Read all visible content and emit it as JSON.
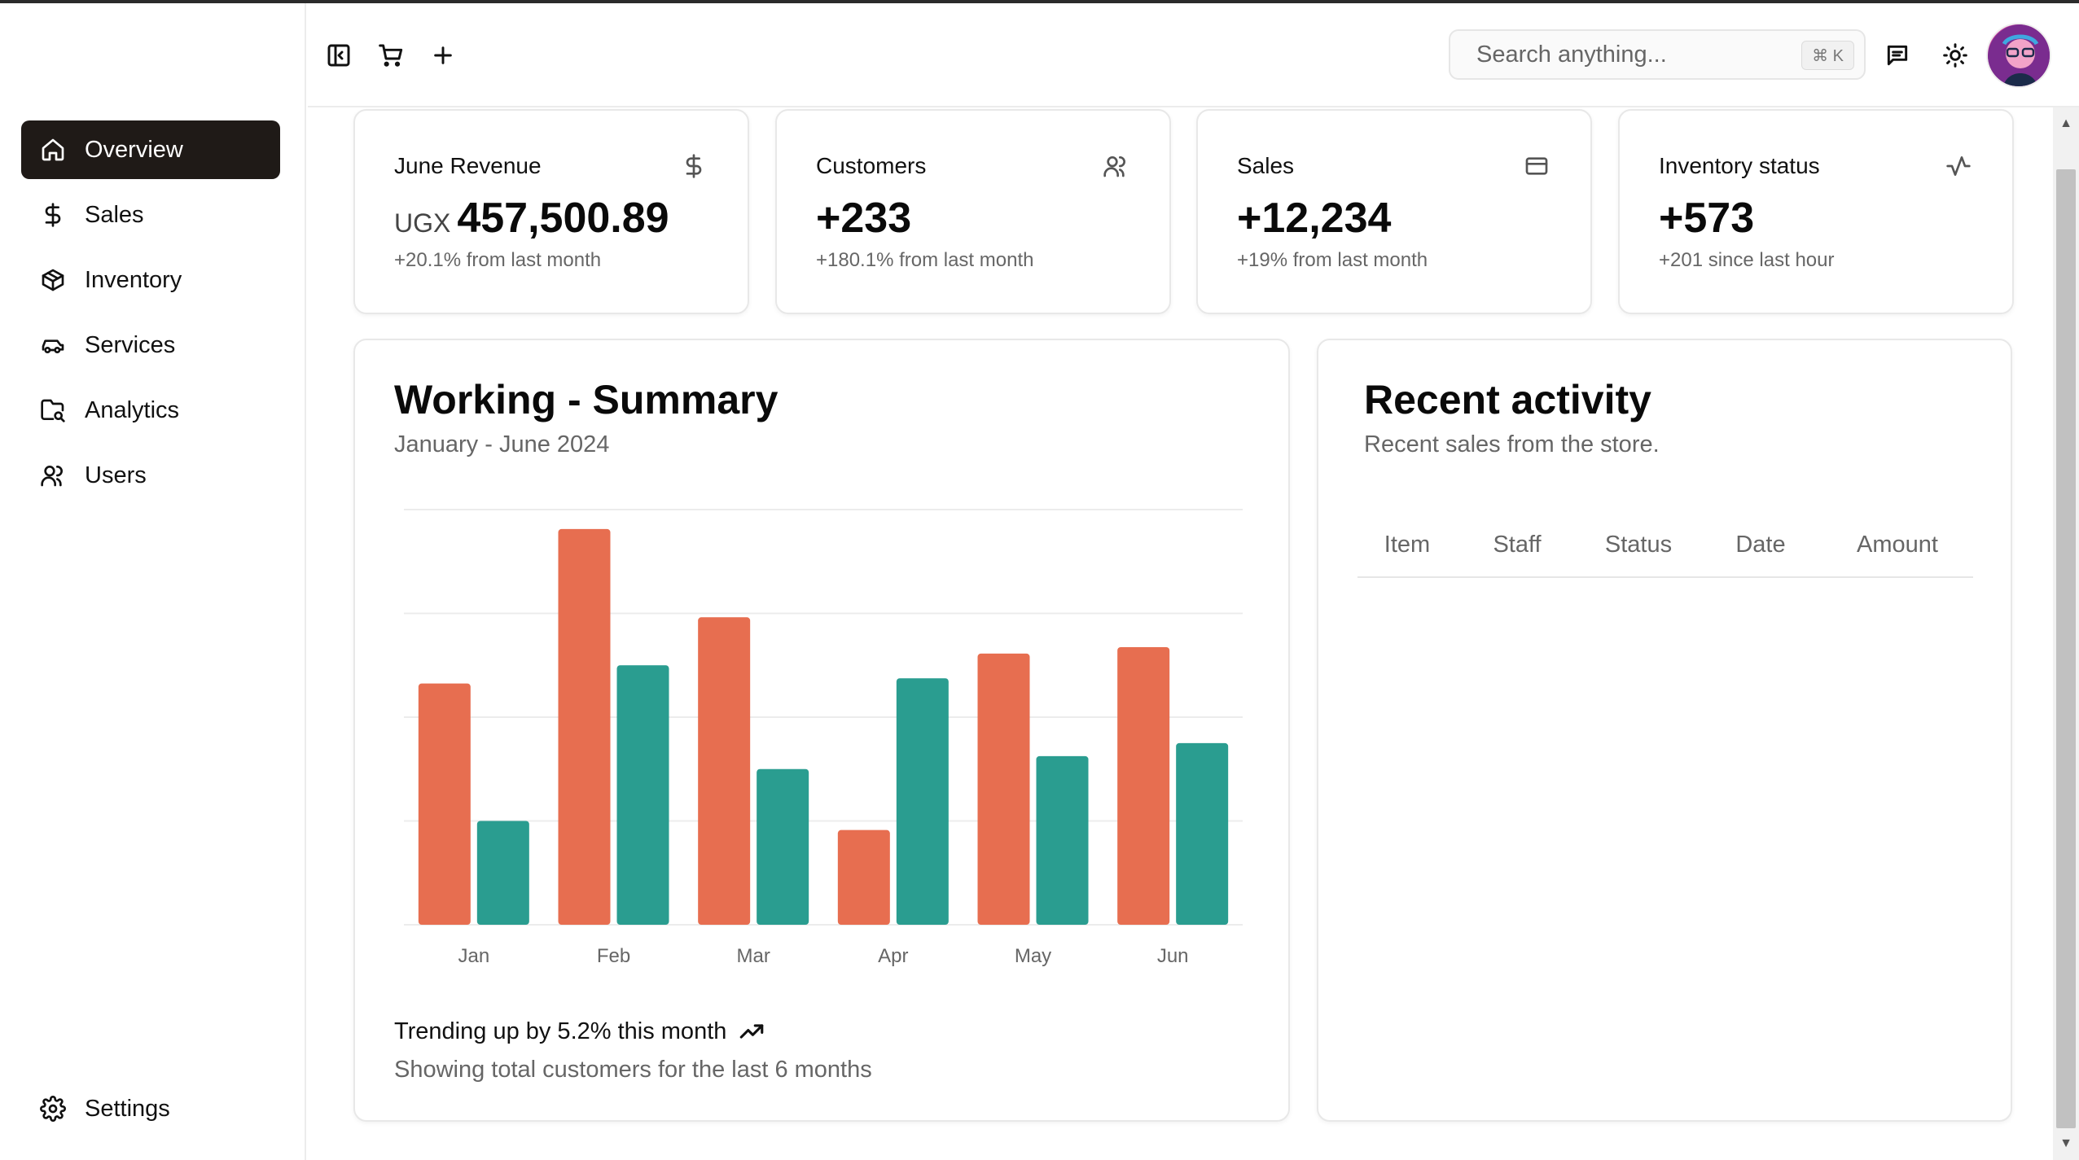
{
  "sidebar": {
    "items": [
      {
        "label": "Overview",
        "icon": "home-icon"
      },
      {
        "label": "Sales",
        "icon": "dollar-icon"
      },
      {
        "label": "Inventory",
        "icon": "package-icon"
      },
      {
        "label": "Services",
        "icon": "car-icon"
      },
      {
        "label": "Analytics",
        "icon": "folder-chart-icon"
      },
      {
        "label": "Users",
        "icon": "users-icon"
      }
    ],
    "settings_label": "Settings",
    "active_item": "Overview"
  },
  "header": {
    "search_placeholder": "Search anything...",
    "search_shortcut": "⌘ K",
    "icons": [
      "sidebar-toggle-icon",
      "cart-icon",
      "plus-icon",
      "message-icon",
      "sun-icon"
    ]
  },
  "stats": [
    {
      "title": "June Revenue",
      "currency": "UGX",
      "value": "457,500.89",
      "sub": "+20.1% from last month",
      "icon": "dollar-icon"
    },
    {
      "title": "Customers",
      "value": "+233",
      "sub": "+180.1% from last month",
      "icon": "users-icon"
    },
    {
      "title": "Sales",
      "value": "+12,234",
      "sub": "+19% from last month",
      "icon": "credit-card-icon"
    },
    {
      "title": "Inventory status",
      "value": "+573",
      "sub": "+201 since last hour",
      "icon": "activity-icon"
    }
  ],
  "summary": {
    "title": "Working - Summary",
    "subtitle": "January - June 2024",
    "footer_trend": "Trending up by 5.2% this month",
    "footer_note": "Showing total customers for the last 6 months"
  },
  "chart_data": {
    "type": "bar",
    "categories": [
      "Jan",
      "Feb",
      "Mar",
      "Apr",
      "May",
      "Jun"
    ],
    "series": [
      {
        "values": [
          186,
          305,
          237,
          73,
          209,
          214
        ],
        "color": "#e76e50"
      },
      {
        "values": [
          80,
          200,
          120,
          190,
          130,
          140
        ],
        "color": "#2a9d90"
      }
    ],
    "ylim": [
      0,
      320
    ],
    "grid": true,
    "yaxis_labels_shown": false
  },
  "activity": {
    "title": "Recent activity",
    "subtitle": "Recent sales from the store.",
    "columns": [
      "Item",
      "Staff",
      "Status",
      "Date",
      "Amount"
    ],
    "rows": []
  },
  "colors": {
    "active_nav_bg": "#1f1a17",
    "bar_primary": "#e76e50",
    "bar_secondary": "#2a9d90"
  }
}
